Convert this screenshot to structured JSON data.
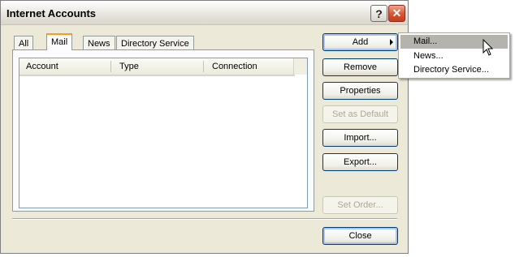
{
  "window": {
    "title": "Internet Accounts"
  },
  "tabs": [
    {
      "label": "All",
      "active": false
    },
    {
      "label": "Mail",
      "active": true
    },
    {
      "label": "News",
      "active": false
    },
    {
      "label": "Directory Service",
      "active": false
    }
  ],
  "list": {
    "columns": [
      "Account",
      "Type",
      "Connection"
    ],
    "rows": []
  },
  "buttons": {
    "add": "Add",
    "remove": "Remove",
    "properties": "Properties",
    "set_default": "Set as Default",
    "import": "Import...",
    "export": "Export...",
    "set_order": "Set Order...",
    "close": "Close"
  },
  "add_menu": {
    "items": [
      "Mail...",
      "News...",
      "Directory Service..."
    ],
    "highlighted": "Mail..."
  },
  "titlebar_icons": {
    "help": "?",
    "close": "✕"
  },
  "colors": {
    "dialog_bg": "#ece9d8",
    "tab_accent": "#ff9a1a",
    "close_red": "#d9542e"
  }
}
